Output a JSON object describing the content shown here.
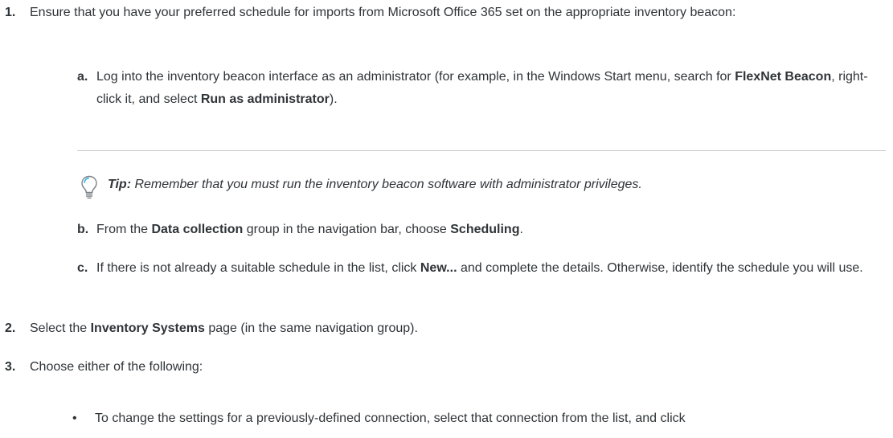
{
  "step1": {
    "num": "1.",
    "text": "Ensure that you have your preferred schedule for imports from Microsoft Office 365 set on the appropriate inventory beacon:"
  },
  "step1a": {
    "letter": "a.",
    "pre": "Log into the inventory beacon interface as an administrator (for example, in the Windows Start menu, search for ",
    "b1": "FlexNet Beacon",
    "mid": ", right-click it, and select ",
    "b2": "Run as administrator",
    "post": ")."
  },
  "tip": {
    "label": "Tip:",
    "text": " Remember that you must run the inventory beacon software with administrator privileges.",
    "icon": "lightbulb-icon"
  },
  "step1b": {
    "letter": "b.",
    "pre": "From the ",
    "b1": "Data collection",
    "mid": " group in the navigation bar, choose ",
    "b2": "Scheduling",
    "post": "."
  },
  "step1c": {
    "letter": "c.",
    "pre": "If there is not already a suitable schedule in the list, click ",
    "b1": "New...",
    "post": " and complete the details. Otherwise, identify the schedule you will use."
  },
  "step2": {
    "num": "2.",
    "pre": "Select the ",
    "b1": "Inventory Systems",
    "post": " page (in the same navigation group)."
  },
  "step3": {
    "num": "3.",
    "text": "Choose either of the following:"
  },
  "bullet1": {
    "dot": "•",
    "text": "To change the settings for a previously-defined connection, select that connection from the list, and click"
  }
}
